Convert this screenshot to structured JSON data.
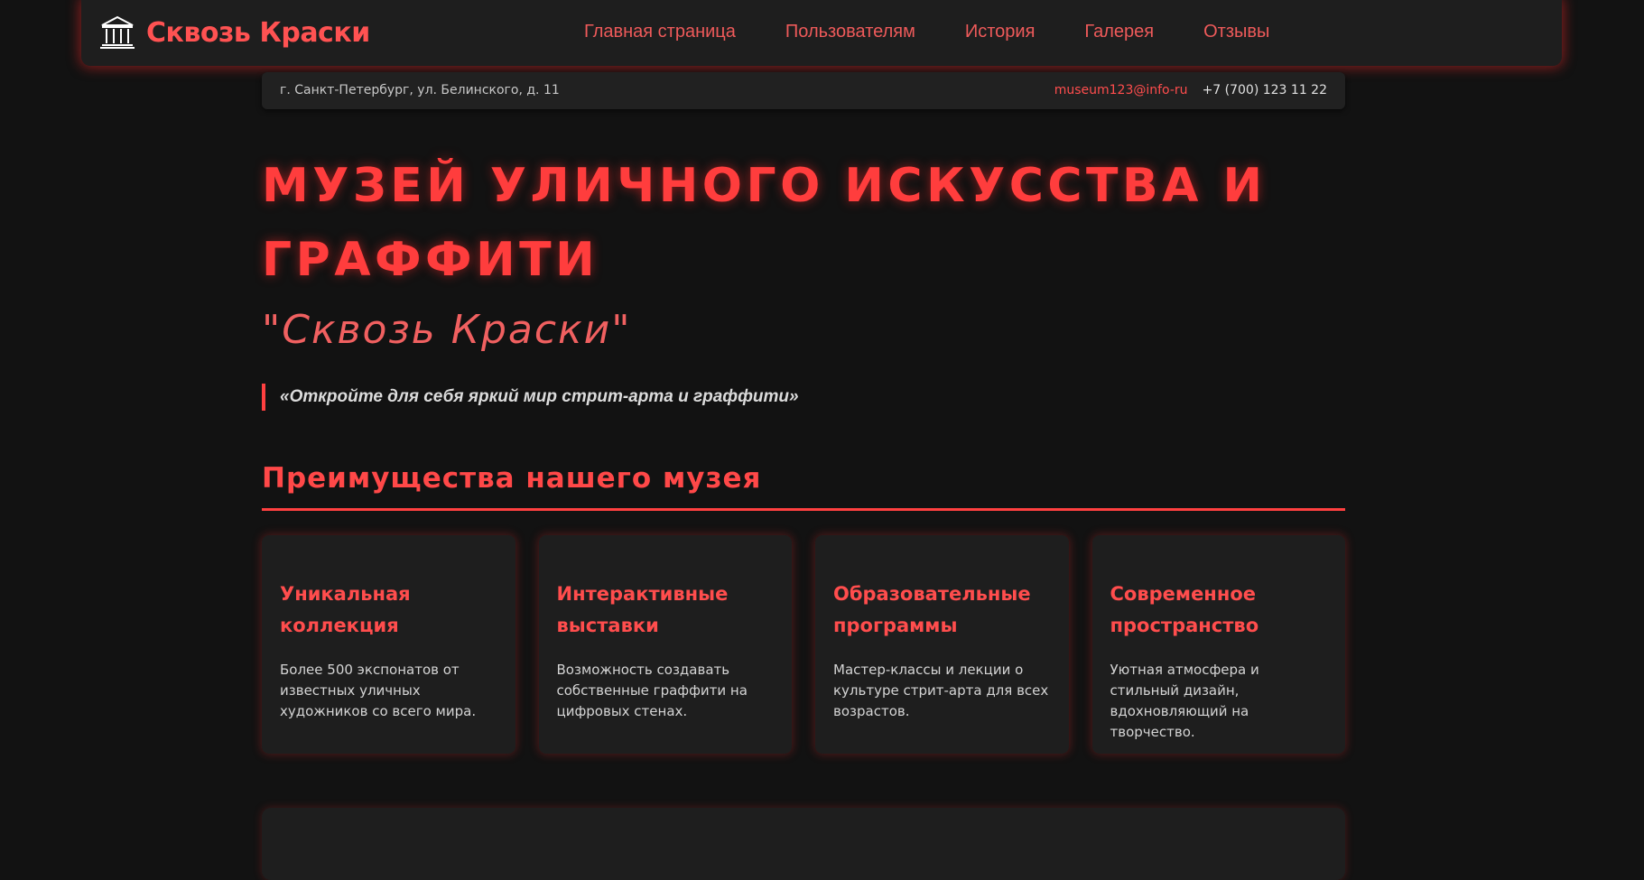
{
  "brand": {
    "name": "Сквозь Краски",
    "icon": "museum-icon"
  },
  "nav": {
    "items": [
      {
        "label": "Главная страница"
      },
      {
        "label": "Пользователям"
      },
      {
        "label": "История"
      },
      {
        "label": "Галерея"
      },
      {
        "label": "Отзывы"
      }
    ]
  },
  "infobar": {
    "address": "г. Санкт-Петербург, ул. Белинского, д. 11",
    "email": "museum123@info-ru",
    "phone": "+7 (700) 123 11 22"
  },
  "hero": {
    "title": "МУЗЕЙ УЛИЧНОГО ИСКУССТВА И ГРАФФИТИ",
    "subtitle": "\"Сквозь Краски\"",
    "quote": "«Откройте для себя яркий мир стрит-арта и граффити»"
  },
  "advantages": {
    "title": "Преимущества нашего музея",
    "cards": [
      {
        "title": "Уникальная коллекция",
        "text": "Более 500 экспонатов от известных уличных художников со всего мира."
      },
      {
        "title": "Интерактивные выставки",
        "text": "Возможность создавать собственные граффити на цифровых стенах."
      },
      {
        "title": "Образовательные программы",
        "text": "Мастер-классы и лекции о культуре стрит-арта для всех возрастов."
      },
      {
        "title": "Современное пространство",
        "text": "Уютная атмосфера и стильный дизайн, вдохновляющий на творчество."
      }
    ]
  },
  "colors": {
    "accent": "#ff4040",
    "background": "#121212",
    "panel": "#1e1e1e"
  }
}
